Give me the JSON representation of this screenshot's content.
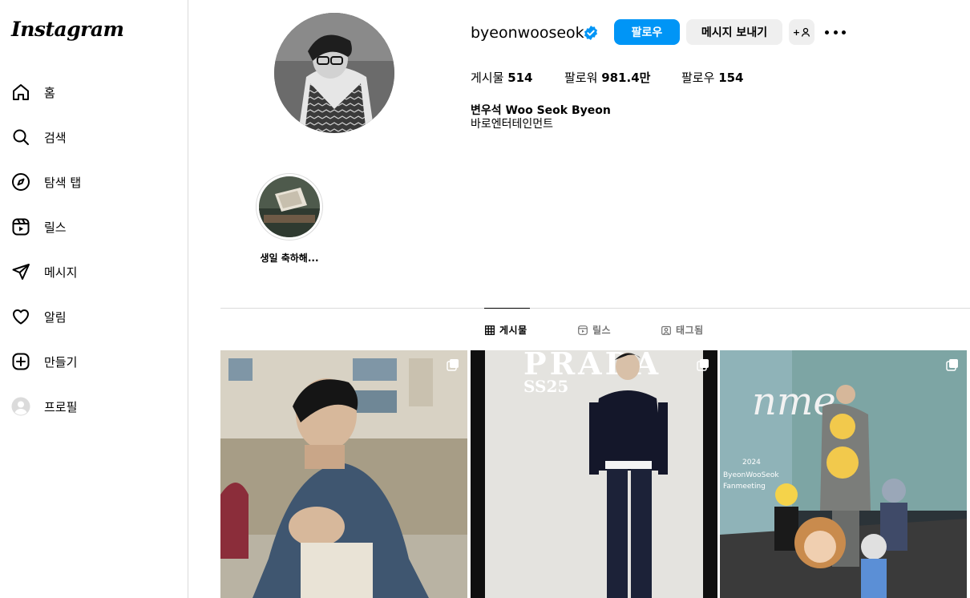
{
  "brand": {
    "logo_text": "Instagram"
  },
  "nav": {
    "items": [
      {
        "id": "home",
        "label": "홈",
        "icon": "home-icon"
      },
      {
        "id": "search",
        "label": "검색",
        "icon": "search-icon"
      },
      {
        "id": "explore",
        "label": "탐색 탭",
        "icon": "compass-icon"
      },
      {
        "id": "reels",
        "label": "릴스",
        "icon": "reels-icon"
      },
      {
        "id": "messages",
        "label": "메시지",
        "icon": "send-icon"
      },
      {
        "id": "notifications",
        "label": "알림",
        "icon": "heart-icon"
      },
      {
        "id": "create",
        "label": "만들기",
        "icon": "plus-square-icon"
      },
      {
        "id": "profile",
        "label": "프로필",
        "icon": "avatar-icon"
      }
    ]
  },
  "profile": {
    "username": "byeonwooseok",
    "verified": true,
    "follow_label": "팔로우",
    "message_label": "메시지 보내기",
    "add_person_label": "+",
    "stats": {
      "posts_label": "게시물",
      "posts_value": "514",
      "followers_label": "팔로워",
      "followers_value": "981.4만",
      "following_label": "팔로우",
      "following_value": "154"
    },
    "full_name": "변우석 Woo Seok Byeon",
    "bio": "바로엔터테인먼트"
  },
  "highlights": [
    {
      "label": "생일 축하해..."
    }
  ],
  "tabs": [
    {
      "label": "게시물",
      "icon": "grid-icon",
      "active": true
    },
    {
      "label": "릴스",
      "icon": "reels-icon",
      "active": false
    },
    {
      "label": "태그됨",
      "icon": "tagged-icon",
      "active": false
    }
  ],
  "posts": [
    {
      "type": "carousel",
      "icon": "multi-post-icon"
    },
    {
      "type": "carousel",
      "icon": "multi-post-icon",
      "caption_text": "PRADA SS25"
    },
    {
      "type": "carousel",
      "icon": "multi-post-icon",
      "caption_text": "2024 ByeonWooSeok Fanmeeting"
    }
  ],
  "colors": {
    "accent": "#0095f6",
    "secondary_button": "#efefef",
    "border": "#dbdbdb",
    "muted_text": "#737373"
  }
}
